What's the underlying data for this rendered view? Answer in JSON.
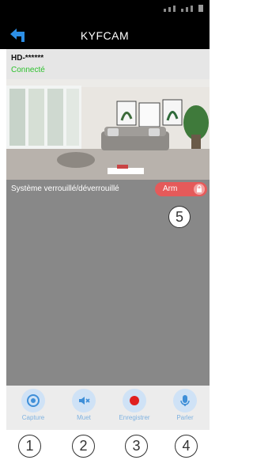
{
  "app": {
    "title": "KYFCAM"
  },
  "device": {
    "name": "HD-******",
    "status": "Connecté"
  },
  "lock": {
    "label": "Système verrouillé/déverrouillé",
    "toggle_label": "Arm"
  },
  "annotations": {
    "marker_5": "5",
    "marker_1": "1",
    "marker_2": "2",
    "marker_3": "3",
    "marker_4": "4"
  },
  "toolbar": {
    "capture": "Capture",
    "mute": "Muet",
    "record": "Enregistrer",
    "talk": "Parler"
  },
  "colors": {
    "connected": "#2ec12e",
    "arm_toggle": "#e55a5a",
    "toolbar_icon": "#3f8fd8",
    "record_icon": "#e02020"
  }
}
